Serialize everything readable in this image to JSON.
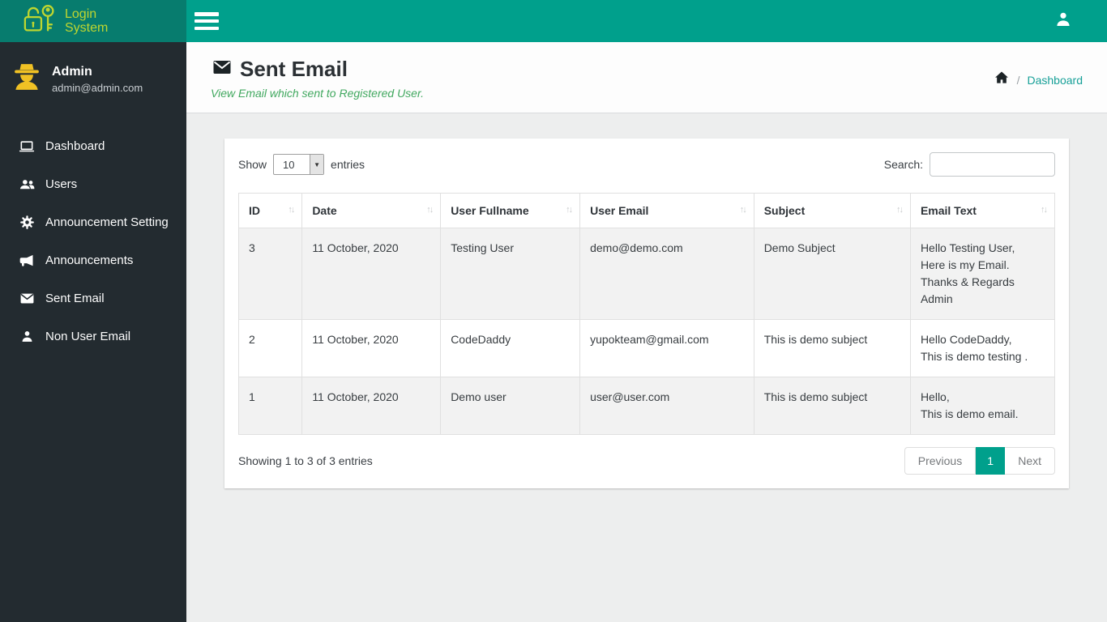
{
  "colors": {
    "topbar_teal": "#00a08c",
    "logo_bg": "#077c6e",
    "logo_text": "#bed630",
    "sidebar_dark": "#232b30",
    "avatar_yellow": "#f0c124",
    "subtitle_green": "#41a85f",
    "breadcrumb_link_teal": "#17a098",
    "pagination_active": "#00a08c",
    "row_stripe": "#f2f2f2"
  },
  "topbar": {
    "logo_line1": "Login",
    "logo_line2": "System"
  },
  "sidebar": {
    "user": {
      "name": "Admin",
      "email": "admin@admin.com"
    },
    "items": [
      {
        "label": "Dashboard",
        "icon": "laptop-icon"
      },
      {
        "label": "Users",
        "icon": "users-icon"
      },
      {
        "label": "Announcement Setting",
        "icon": "gear-icon"
      },
      {
        "label": "Announcements",
        "icon": "bullhorn-icon"
      },
      {
        "label": "Sent Email",
        "icon": "envelope-icon"
      },
      {
        "label": "Non User Email",
        "icon": "person-icon"
      }
    ]
  },
  "page": {
    "title": "Sent Email",
    "subtitle": "View Email which sent to Registered User.",
    "breadcrumb": {
      "home_icon": "home-icon",
      "separator": "/",
      "link": "Dashboard"
    }
  },
  "table": {
    "show_label": "Show",
    "page_length": "10",
    "entries_label": "entries",
    "search_label": "Search:",
    "dropdown_icon": "▼",
    "sort_icon": "↑↓",
    "columns": [
      "ID",
      "Date",
      "User Fullname",
      "User Email",
      "Subject",
      "Email Text"
    ],
    "rows": [
      {
        "id": "3",
        "date": "11 October, 2020",
        "fullname": "Testing User",
        "email": "demo@demo.com",
        "subject": "Demo Subject",
        "text_lines": [
          "Hello Testing User,",
          "Here is my Email.",
          "Thanks & Regards",
          "Admin"
        ]
      },
      {
        "id": "2",
        "date": "11 October, 2020",
        "fullname": "CodeDaddy",
        "email": "yupokteam@gmail.com",
        "subject": "This is demo subject",
        "text_lines": [
          "Hello CodeDaddy,",
          "This is demo testing ."
        ]
      },
      {
        "id": "1",
        "date": "11 October, 2020",
        "fullname": "Demo user",
        "email": "user@user.com",
        "subject": "This is demo subject",
        "text_lines": [
          "Hello,",
          "This is demo email."
        ]
      }
    ],
    "info": "Showing 1 to 3 of 3 entries",
    "pagination": {
      "previous": "Previous",
      "current": "1",
      "next": "Next"
    }
  }
}
